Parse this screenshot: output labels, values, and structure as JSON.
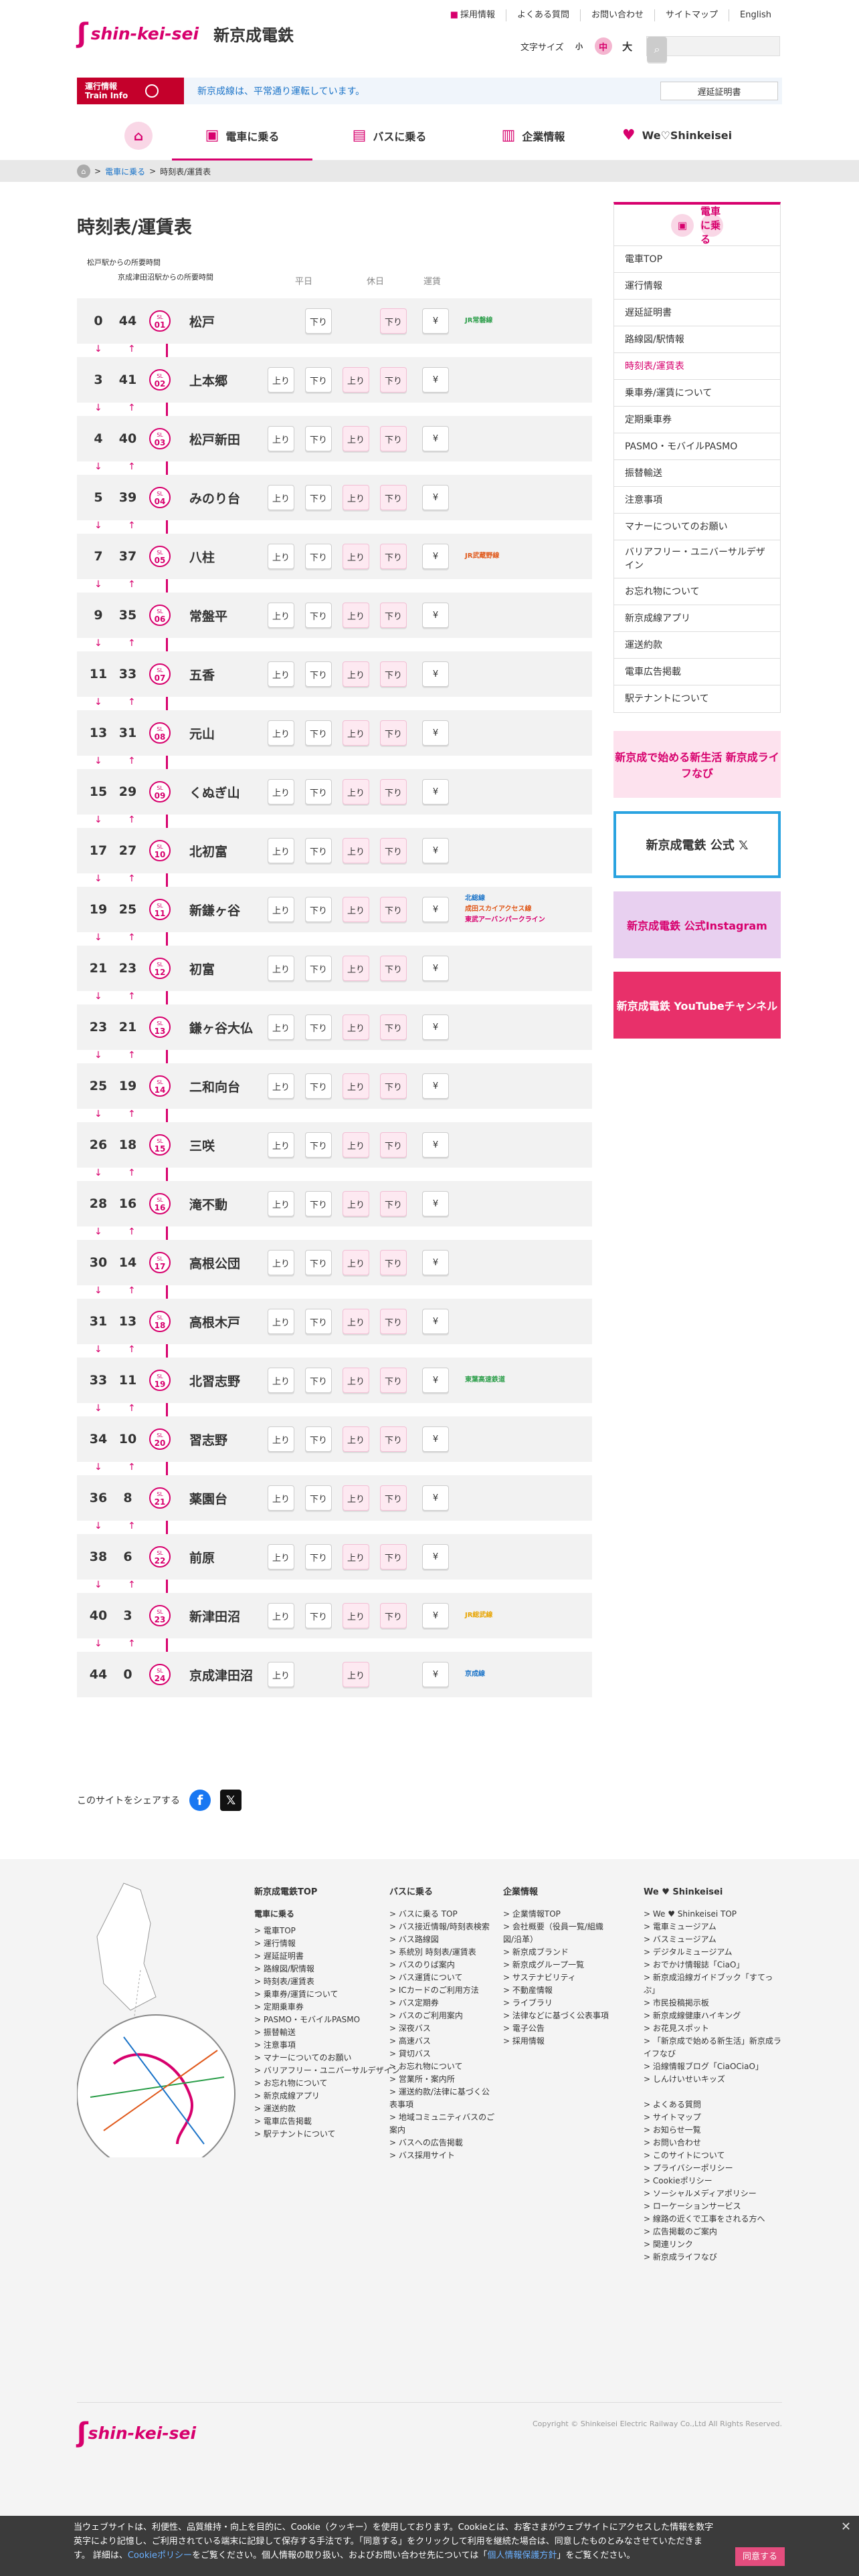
{
  "header": {
    "logo_en": "shin-kei-sei",
    "logo_ja": "新京成電鉄",
    "util_links": [
      "採用情報",
      "よくある質問",
      "お問い合わせ",
      "サイトマップ",
      "English"
    ],
    "font_size_label": "文字サイズ",
    "font_sizes": [
      "小",
      "中",
      "大"
    ],
    "search_placeholder": "",
    "op_label": "運行情報 Train Info",
    "op_message": "新京成線は、平常通り運転しています。",
    "cert_button": "遅延証明書"
  },
  "nav": {
    "home": "⌂",
    "items": [
      "電車に乗る",
      "バスに乗る",
      "企業情報",
      "We♡Shinkeisei"
    ]
  },
  "breadcrumb": {
    "home": "⌂",
    "parent": "電車に乗る",
    "sep": ">",
    "current": "時刻表/運賃表"
  },
  "page_title": "時刻表/運賃表",
  "legend": {
    "line1": "松戸駅からの所要時間",
    "line2": "京成津田沼駅からの所要時間"
  },
  "columns": {
    "weekday": "平日",
    "holiday": "休日",
    "fare": "運賃"
  },
  "labels": {
    "up": "上り",
    "down": "下り",
    "yen": "¥",
    "arrow_down": "↓",
    "arrow_up": "↑"
  },
  "stations": [
    {
      "h": "0",
      "m": "44",
      "code": "01",
      "name": "松戸",
      "transfer": [
        "JR常磐線"
      ],
      "tcolor": [
        "#2c9e4a"
      ]
    },
    {
      "h": "3",
      "m": "41",
      "code": "02",
      "name": "上本郷",
      "transfer": [],
      "tcolor": []
    },
    {
      "h": "4",
      "m": "40",
      "code": "03",
      "name": "松戸新田",
      "transfer": [],
      "tcolor": []
    },
    {
      "h": "5",
      "m": "39",
      "code": "04",
      "name": "みのり台",
      "transfer": [],
      "tcolor": []
    },
    {
      "h": "7",
      "m": "37",
      "code": "05",
      "name": "八柱",
      "transfer": [
        "JR武蔵野線"
      ],
      "tcolor": [
        "#e0581a"
      ]
    },
    {
      "h": "9",
      "m": "35",
      "code": "06",
      "name": "常盤平",
      "transfer": [],
      "tcolor": []
    },
    {
      "h": "11",
      "m": "33",
      "code": "07",
      "name": "五香",
      "transfer": [],
      "tcolor": []
    },
    {
      "h": "13",
      "m": "31",
      "code": "08",
      "name": "元山",
      "transfer": [],
      "tcolor": []
    },
    {
      "h": "15",
      "m": "29",
      "code": "09",
      "name": "くぬぎ山",
      "transfer": [],
      "tcolor": []
    },
    {
      "h": "17",
      "m": "27",
      "code": "10",
      "name": "北初富",
      "transfer": [],
      "tcolor": []
    },
    {
      "h": "19",
      "m": "25",
      "code": "11",
      "name": "新鎌ヶ谷",
      "transfer": [
        "北総線",
        "成田スカイアクセス線",
        "東武アーバンパークライン"
      ],
      "tcolor": [
        "#1a73c8",
        "#e0581a",
        "#d7006d"
      ]
    },
    {
      "h": "21",
      "m": "23",
      "code": "12",
      "name": "初富",
      "transfer": [],
      "tcolor": []
    },
    {
      "h": "23",
      "m": "21",
      "code": "13",
      "name": "鎌ヶ谷大仏",
      "transfer": [],
      "tcolor": []
    },
    {
      "h": "25",
      "m": "19",
      "code": "14",
      "name": "二和向台",
      "transfer": [],
      "tcolor": []
    },
    {
      "h": "26",
      "m": "18",
      "code": "15",
      "name": "三咲",
      "transfer": [],
      "tcolor": []
    },
    {
      "h": "28",
      "m": "16",
      "code": "16",
      "name": "滝不動",
      "transfer": [],
      "tcolor": []
    },
    {
      "h": "30",
      "m": "14",
      "code": "17",
      "name": "高根公団",
      "transfer": [],
      "tcolor": []
    },
    {
      "h": "31",
      "m": "13",
      "code": "18",
      "name": "高根木戸",
      "transfer": [],
      "tcolor": []
    },
    {
      "h": "33",
      "m": "11",
      "code": "19",
      "name": "北習志野",
      "transfer": [
        "東葉高速鉄道"
      ],
      "tcolor": [
        "#2c9e4a"
      ]
    },
    {
      "h": "34",
      "m": "10",
      "code": "20",
      "name": "習志野",
      "transfer": [],
      "tcolor": []
    },
    {
      "h": "36",
      "m": "8",
      "code": "21",
      "name": "薬園台",
      "transfer": [],
      "tcolor": []
    },
    {
      "h": "38",
      "m": "6",
      "code": "22",
      "name": "前原",
      "transfer": [],
      "tcolor": []
    },
    {
      "h": "40",
      "m": "3",
      "code": "23",
      "name": "新津田沼",
      "transfer": [
        "JR総武線"
      ],
      "tcolor": [
        "#e8a400"
      ]
    },
    {
      "h": "44",
      "m": "0",
      "code": "24",
      "name": "京成津田沼",
      "transfer": [
        "京成線"
      ],
      "tcolor": [
        "#1a73c8"
      ]
    }
  ],
  "sidebar": {
    "title": "電車に乗る",
    "items": [
      "電車TOP",
      "運行情報",
      "遅延証明書",
      "路線図/駅情報",
      "時刻表/運賃表",
      "乗車券/運賃について",
      "定期乗車券",
      "PASMO・モバイルPASMO",
      "振替輸送",
      "注意事項",
      "マナーについてのお願い",
      "バリアフリー・ユニバーサルデザイン",
      "お忘れ物について",
      "新京成線アプリ",
      "運送約款",
      "電車広告掲載",
      "駅テナントについて"
    ],
    "banners": [
      "新京成で始める新生活 新京成ライフなび",
      "新京成電鉄 公式 𝕏",
      "新京成電鉄 公式Instagram",
      "新京成電鉄 YouTubeチャンネル"
    ]
  },
  "share": {
    "label": "このサイトをシェアする",
    "fb": "f",
    "x": "𝕏"
  },
  "footer": {
    "col1": {
      "title": "新京成電鉄TOP",
      "sub": "電車に乗る",
      "items": [
        "電車TOP",
        "運行情報",
        "遅延証明書",
        "路線図/駅情報",
        "時刻表/運賃表",
        "乗車券/運賃について",
        "定期乗車券",
        "PASMO・モバイルPASMO",
        "振替輸送",
        "注意事項",
        "マナーについてのお願い",
        "バリアフリー・ユニバーサルデザイン",
        "お忘れ物について",
        "新京成線アプリ",
        "運送約款",
        "電車広告掲載",
        "駅テナントについて"
      ]
    },
    "col2": {
      "title": "バスに乗る",
      "items": [
        "バスに乗る TOP",
        "バス接近情報/時刻表検索",
        "バス路線図",
        "系統別 時刻表/運賃表",
        "バスのりば案内",
        "バス運賃について",
        "ICカードのご利用方法",
        "バス定期券",
        "バスのご利用案内",
        "深夜バス",
        "高速バス",
        "貸切バス",
        "お忘れ物について",
        "営業所・案内所",
        "運送約款/法律に基づく公表事項",
        "地域コミュニティバスのご案内",
        "バスへの広告掲載",
        "バス採用サイト"
      ]
    },
    "col3": {
      "title": "企業情報",
      "items": [
        "企業情報TOP",
        "会社概要（役員一覧/組織図/沿革）",
        "新京成ブランド",
        "新京成グループ一覧",
        "サステナビリティ",
        "不動産情報",
        "ライブラリ",
        "法律などに基づく公表事項",
        "電子公告",
        "採用情報"
      ]
    },
    "col4": {
      "title": "We ♥ Shinkeisei",
      "items": [
        "We ♥ Shinkeisei TOP",
        "電車ミュージアム",
        "バスミュージアム",
        "デジタルミュージアム",
        "おでかけ情報誌「CiaO」",
        "新京成沿線ガイドブック「すてっぷ」",
        "市民投稿掲示板",
        "新京成線健康ハイキング",
        "お花見スポット",
        "「新京成で始める新生活」新京成ライフなび",
        "沿線情報ブログ「CiaOCiaO」",
        "しんけいせいキッズ",
        "",
        "よくある質問",
        "サイトマップ",
        "お知らせ一覧",
        "お問い合わせ",
        "このサイトについて",
        "プライバシーポリシー",
        "Cookieポリシー",
        "ソーシャルメディアポリシー",
        "ローケーションサービス",
        "線路の近くで工事をされる方へ",
        "広告掲載のご案内",
        "関連リンク",
        "新京成ライフなび"
      ]
    },
    "logo": "shin-kei-sei",
    "copyright": "Copyright © Shinkeisei Electric Railway Co.,Ltd All Rights Reserved."
  },
  "cookie": {
    "text1": "当ウェブサイトは、利便性、品質維持・向上を目的に、Cookie（クッキー）を使用しております。Cookieとは、お客さまがウェブサイトにアクセスした情報を数字英字により記憶し、ご利用されている端末に記録して保存する手法です。「同意する」をクリックして利用を継続た場合は、同意したものとみなさせていただきます。 詳細は、",
    "link1": "Cookieポリシー",
    "text2": "をご覧ください。個人情報の取り扱い、およびお問い合わせ先については「",
    "link2": "個人情報保護方針",
    "text3": "」をご覧ください。",
    "agree": "同意する",
    "close": "✕"
  }
}
